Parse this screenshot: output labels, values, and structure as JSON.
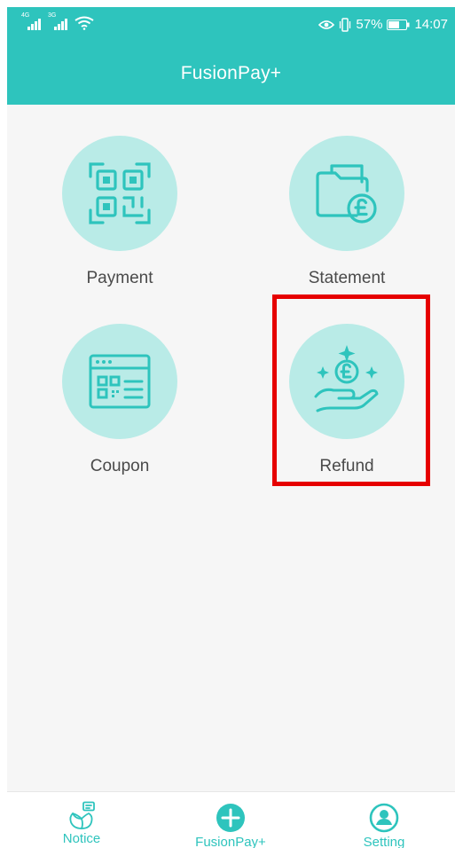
{
  "status_bar": {
    "sim1_tag": "4G",
    "sim2_tag": "3G",
    "battery_percent": "57%",
    "time": "14:07"
  },
  "header": {
    "title": "FusionPay+"
  },
  "menu": {
    "items": [
      {
        "label": "Payment",
        "icon": "qr-code-icon"
      },
      {
        "label": "Statement",
        "icon": "folder-pound-icon"
      },
      {
        "label": "Coupon",
        "icon": "qr-window-icon"
      },
      {
        "label": "Refund",
        "icon": "hand-coin-icon"
      }
    ]
  },
  "highlighted_item": "Refund",
  "tabbar": {
    "tabs": [
      {
        "label": "Notice",
        "icon": "notice-icon"
      },
      {
        "label": "FusionPay+",
        "icon": "plus-circle-icon"
      },
      {
        "label": "Setting",
        "icon": "profile-icon"
      }
    ]
  },
  "colors": {
    "accent": "#2ec4bd",
    "icon_circle": "#b9ebe7",
    "highlight": "#e60000"
  }
}
